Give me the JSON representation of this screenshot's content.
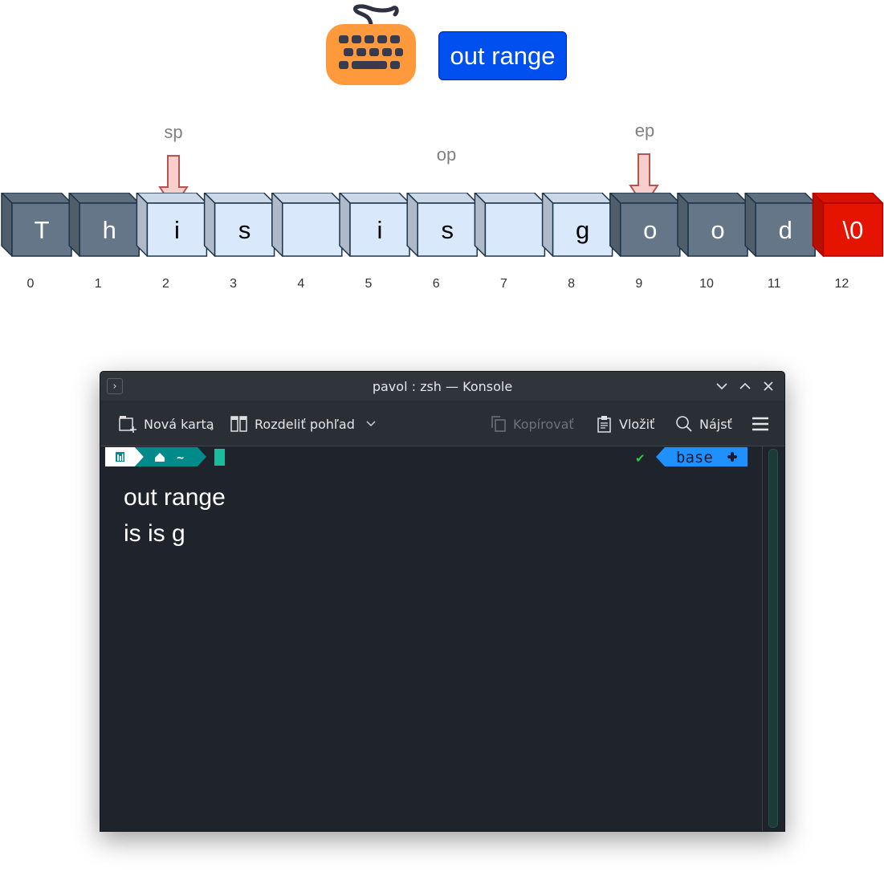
{
  "top_button": {
    "label": "out range"
  },
  "pointers": {
    "sp": "sp",
    "op": "op",
    "ep": "ep"
  },
  "array": {
    "chars": [
      "T",
      "h",
      "i",
      "s",
      "",
      "i",
      "s",
      "",
      "g",
      "o",
      "o",
      "d",
      "\\0"
    ],
    "indices": [
      "0",
      "1",
      "2",
      "3",
      "4",
      "5",
      "6",
      "7",
      "8",
      "9",
      "10",
      "11",
      "12"
    ],
    "highlight_start": 2,
    "highlight_end": 8,
    "colors": {
      "normal": "#647687",
      "highlight": "#dae8fc",
      "terminator": "#e51400",
      "border": "#1d3349"
    }
  },
  "konsole": {
    "title": "pavol : zsh — Konsole",
    "toolbar": {
      "new_tab": "Nová karta",
      "split_view": "Rozdeliť pohľad",
      "copy": "Kopírovať",
      "paste": "Vložiť",
      "find": "Nájsť"
    },
    "prompt": {
      "home": "~",
      "check": "✔",
      "env": "base"
    },
    "output": [
      "out range",
      "is is g"
    ],
    "colors": {
      "background": "#1f232b",
      "prompt_teal": "#008a8a",
      "env_blue": "#1e90ff"
    }
  }
}
